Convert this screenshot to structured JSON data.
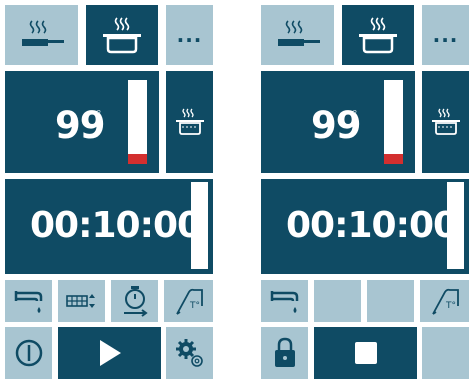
{
  "left_panel": {
    "top_bar": {
      "pan_mode_icon": "frying-pan-steam-icon",
      "pot_mode_icon": "cooking-pot-steam-icon",
      "more_label": "..."
    },
    "temperature": {
      "value": "99",
      "unit": "°",
      "gauge_level": 0.12,
      "gauge_fill_color": "#d32f2f",
      "program_icon": "steaming-pot-icon"
    },
    "timer": {
      "value": "00:10:00",
      "gauge_level": 0.0
    },
    "controls": {
      "icons": [
        "water-tap-icon",
        "grid-heat-icon",
        "timer-start-icon",
        "core-probe-icon"
      ]
    },
    "bottom_bar": {
      "icons": [
        "power-icon",
        "play-icon",
        "settings-gears-icon"
      ]
    }
  },
  "right_panel": {
    "top_bar": {
      "pan_mode_icon": "frying-pan-steam-icon",
      "pot_mode_icon": "cooking-pot-steam-icon",
      "more_label": "..."
    },
    "temperature": {
      "value": "99",
      "unit": "°",
      "gauge_level": 0.12,
      "gauge_fill_color": "#d32f2f",
      "program_icon": "steaming-pot-icon"
    },
    "timer": {
      "value": "00:10:00",
      "gauge_level": 0.0
    },
    "controls": {
      "icons": [
        "water-tap-icon",
        "core-probe-icon"
      ]
    },
    "bottom_bar": {
      "icons": [
        "lock-icon",
        "stop-icon"
      ]
    }
  },
  "colors": {
    "dark_tile": "#0f4b64",
    "light_tile": "#a8c5d1",
    "background": "#ffffff"
  }
}
